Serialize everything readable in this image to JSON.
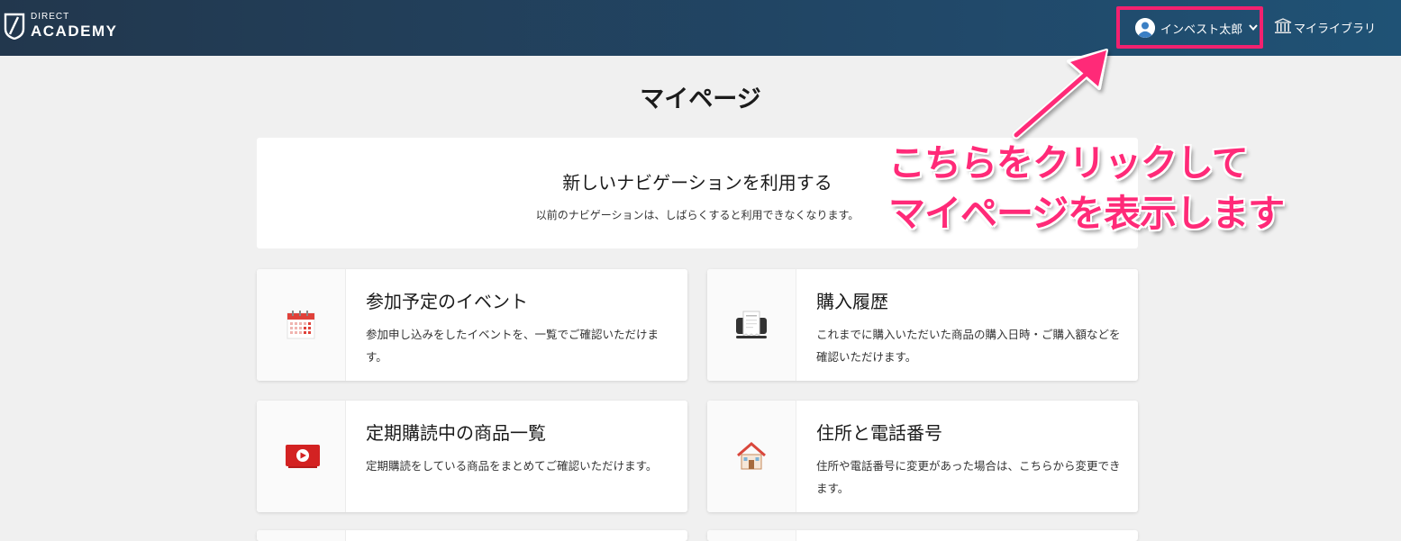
{
  "header": {
    "logo_small": "DIRECT",
    "logo_big": "ACADEMY",
    "user_name": "インベスト太郎",
    "library_label": "マイライブラリ"
  },
  "page": {
    "title": "マイページ"
  },
  "banner": {
    "title": "新しいナビゲーションを利用する",
    "subtitle": "以前のナビゲーションは、しばらくすると利用できなくなります。"
  },
  "cards": [
    {
      "title": "参加予定のイベント",
      "description": "参加申し込みをしたイベントを、一覧でご確認いただけます。",
      "icon": "calendar-icon"
    },
    {
      "title": "購入履歴",
      "description": "これまでに購入いただいた商品の購入日時・ご購入額などを確認いただけます。",
      "icon": "receipt-icon"
    },
    {
      "title": "定期購読中の商品一覧",
      "description": "定期購読をしている商品をまとめてご確認いただけます。",
      "icon": "video-play-icon"
    },
    {
      "title": "住所と電話番号",
      "description": "住所や電話番号に変更があった場合は、こちらから変更できます。",
      "icon": "house-icon"
    }
  ],
  "annotation": {
    "line1": "こちらをクリックして",
    "line2": "マイページを表示します"
  },
  "colors": {
    "header_bg": "#21496a",
    "highlight": "#f2216f",
    "annotation_text": "#ff2a78",
    "page_bg": "#f0f0f0"
  }
}
